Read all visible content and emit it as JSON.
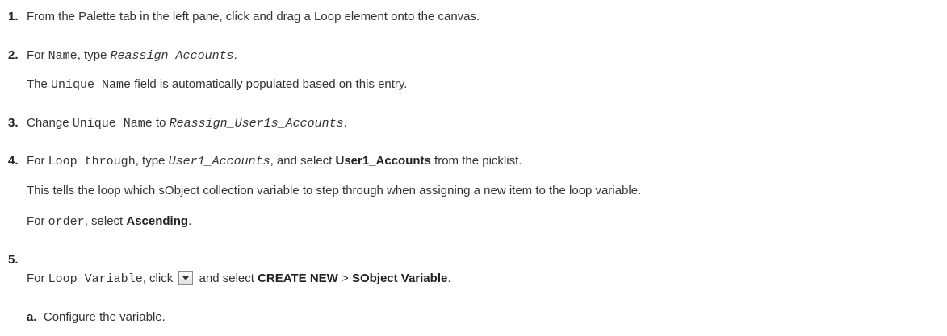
{
  "steps": [
    {
      "number": "1.",
      "text": "From the Palette tab in the left pane, click and drag a Loop element onto the canvas."
    },
    {
      "number": "2.",
      "a": "For ",
      "a_code": "Name",
      "b": ", type ",
      "b_value": "Reassign Accounts",
      "c": ".",
      "note_code": "Unique Name",
      "note": " field is automatically populated based on this entry.",
      "note_prefix": "The "
    },
    {
      "number": "3.",
      "a": "Change ",
      "a_code": "Unique Name",
      "b": " to ",
      "b_value": "Reassign_User1s_Accounts",
      "c": "."
    },
    {
      "number": "4.",
      "a": "For ",
      "a_code": "Loop through",
      "b": ", type ",
      "b_value": "User1_Accounts",
      "c": ", and select ",
      "c_bold": "User1_Accounts",
      "d": " from the picklist.",
      "note": "This tells the loop which sObject collection variable to step through when assigning a new item to the loop variable.",
      "order_a": "For ",
      "order_code": "order",
      "order_b": ", select ",
      "order_bold": "Ascending",
      "order_c": "."
    },
    {
      "number": "5.",
      "a": "For ",
      "a_code": "Loop Variable",
      "b": ", click ",
      "c": " and select ",
      "c_bold1": "CREATE NEW",
      "sep": " > ",
      "c_bold2": "SObject Variable",
      "d": ".",
      "button_icon": "dropdown-arrow-icon"
    }
  ],
  "substeps": [
    {
      "letter": "a.",
      "text": "Configure the variable."
    }
  ]
}
